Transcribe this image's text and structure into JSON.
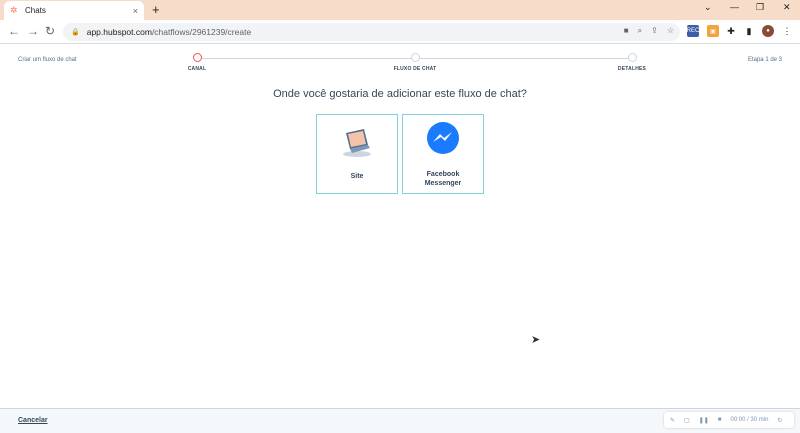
{
  "browser": {
    "tab_title": "Chats",
    "tab_close": "×",
    "new_tab": "+",
    "url_host": "app.hubspot.com",
    "url_path": "/chatflows/2961239/create",
    "ext_rec_label": "REC"
  },
  "wizard": {
    "breadcrumb": "Criar um fluxo de chat",
    "step_counter": "Etapa 1 de 3",
    "steps": [
      {
        "label": "CANAL"
      },
      {
        "label": "FLUXO DE CHAT"
      },
      {
        "label": "DETALHES"
      }
    ],
    "question": "Onde você gostaria de adicionar este fluxo de chat?",
    "options": [
      {
        "label": "Site",
        "icon": "laptop-icon"
      },
      {
        "label": "Facebook Messenger",
        "icon": "messenger-icon"
      }
    ]
  },
  "footer": {
    "cancel_label": "Cancelar"
  },
  "recorder": {
    "time": "00:00 / 30 min"
  },
  "colors": {
    "hubspot_orange": "#ff7a59",
    "messenger_blue": "#1a7bff",
    "card_border": "#7fd1de",
    "active_step": "#f2545b"
  }
}
